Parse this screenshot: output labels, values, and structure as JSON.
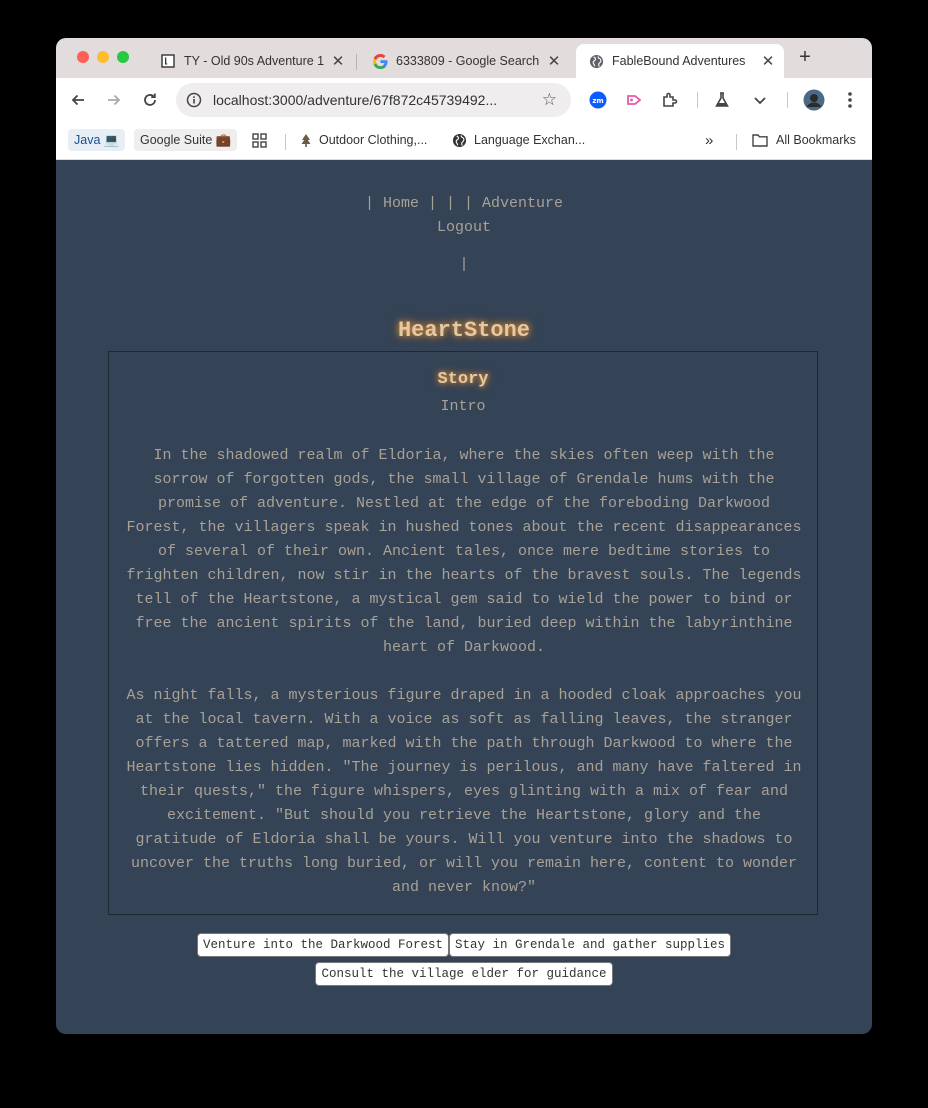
{
  "browser": {
    "tabs": [
      {
        "title": "TY - Old 90s Adventure 1",
        "icon": "notion-icon"
      },
      {
        "title": "6333809 - Google Search",
        "icon": "google-icon"
      },
      {
        "title": "FableBound Adventures",
        "icon": "globe-icon",
        "active": true
      }
    ],
    "url": "localhost:3000/adventure/67f872c45739492...",
    "bookmarks": [
      {
        "label": "Java 💻"
      },
      {
        "label": "Google Suite 💼"
      },
      {
        "label": "Outdoor Clothing,..."
      },
      {
        "label": "Language Exchan..."
      },
      {
        "label": "All Bookmarks"
      }
    ]
  },
  "nav": {
    "line1": "| Home | | | Adventure",
    "line2": "Logout",
    "line3": "|"
  },
  "page": {
    "title": "HeartStone",
    "story_heading": "Story",
    "story_subheading": "Intro",
    "paragraph1": "In the shadowed realm of Eldoria, where the skies often weep with the sorrow of forgotten gods, the small village of Grendale hums with the promise of adventure. Nestled at the edge of the foreboding Darkwood Forest, the villagers speak in hushed tones about the recent disappearances of several of their own. Ancient tales, once mere bedtime stories to frighten children, now stir in the hearts of the bravest souls. The legends tell of the Heartstone, a mystical gem said to wield the power to bind or free the ancient spirits of the land, buried deep within the labyrinthine heart of Darkwood.",
    "paragraph2": "As night falls, a mysterious figure draped in a hooded cloak approaches you at the local tavern. With a voice as soft as falling leaves, the stranger offers a tattered map, marked with the path through Darkwood to where the Heartstone lies hidden. \"The journey is perilous, and many have faltered in their quests,\" the figure whispers, eyes glinting with a mix of fear and excitement. \"But should you retrieve the Heartstone, glory and the gratitude of Eldoria shall be yours. Will you venture into the shadows to uncover the truths long buried, or will you remain here, content to wonder and never know?\"",
    "choices": [
      "Venture into the Darkwood Forest",
      "Stay in Grendale and gather supplies",
      "Consult the village elder for guidance"
    ]
  },
  "colors": {
    "page_bg": "#344356",
    "text": "#a8a196",
    "title_glow": "#d18a3a"
  }
}
